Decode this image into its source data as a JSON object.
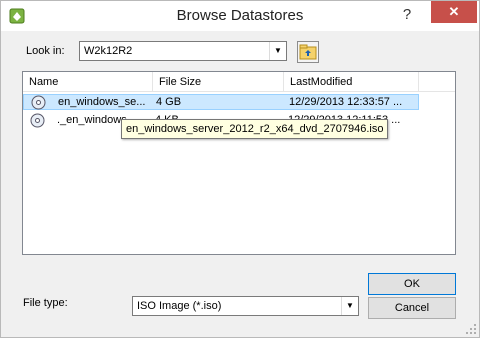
{
  "window": {
    "title": "Browse Datastores",
    "help_glyph": "?",
    "close_glyph": "✕"
  },
  "lookin": {
    "label": "Look in:",
    "value": "W2k12R2"
  },
  "columns": {
    "name": "Name",
    "size": "File Size",
    "modified": "LastModified"
  },
  "files": [
    {
      "name": "en_windows_se...",
      "size": "4 GB",
      "modified": "12/29/2013 12:33:57 ...",
      "selected": true
    },
    {
      "name": "._en_windows_...",
      "size": "4 KB",
      "modified": "12/29/2013 12:11:53 ...",
      "selected": false
    }
  ],
  "tooltip": "en_windows_server_2012_r2_x64_dvd_2707946.iso",
  "filetype": {
    "label": "File type:",
    "value": "ISO Image (*.iso)"
  },
  "buttons": {
    "ok": "OK",
    "cancel": "Cancel"
  },
  "colors": {
    "selection": "#cce8ff",
    "close": "#c7504a",
    "tooltip_bg": "#ffffe1"
  }
}
